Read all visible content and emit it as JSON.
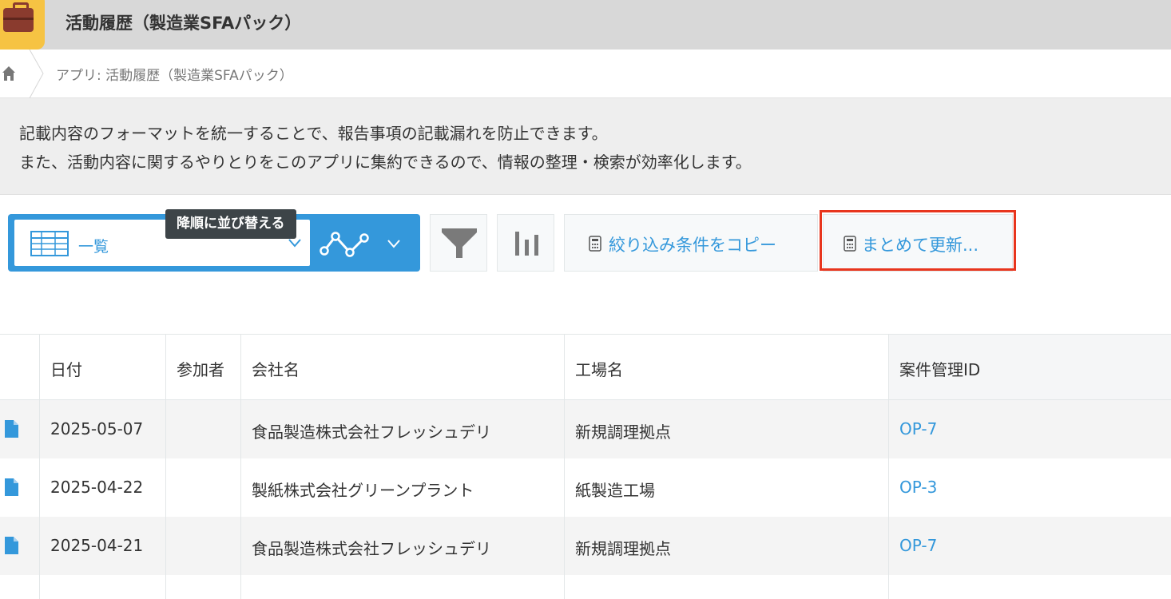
{
  "header": {
    "app_title": "活動履歴（製造業SFAパック）",
    "app_icon": "briefcase-icon"
  },
  "breadcrumb": {
    "home_icon": "home-icon",
    "path": "アプリ: 活動履歴（製造業SFAパック）"
  },
  "description": {
    "line1": "記載内容のフォーマットを統一することで、報告事項の記載漏れを防止できます。",
    "line2": "また、活動内容に関するやりとりをこのアプリに集約できるので、情報の整理・検索が効率化します。"
  },
  "toolbar": {
    "view_label": "一覧",
    "tooltip": "降順に並び替える",
    "copy_filter_label": "絞り込み条件をコピー",
    "bulk_update_label": "まとめて更新...",
    "accent_color": "#3498db",
    "highlight_color": "#e8351d"
  },
  "table": {
    "columns": [
      "日付",
      "参加者",
      "会社名",
      "工場名",
      "案件管理ID"
    ],
    "rows": [
      {
        "date": "2025-05-07",
        "participants": "",
        "company": "食品製造株式会社フレッシュデリ",
        "factory": "新規調理拠点",
        "deal_id": "OP-7"
      },
      {
        "date": "2025-04-22",
        "participants": "",
        "company": "製紙株式会社グリーンプラント",
        "factory": "紙製造工場",
        "deal_id": "OP-3"
      },
      {
        "date": "2025-04-21",
        "participants": "",
        "company": "食品製造株式会社フレッシュデリ",
        "factory": "新規調理拠点",
        "deal_id": "OP-7"
      }
    ]
  }
}
